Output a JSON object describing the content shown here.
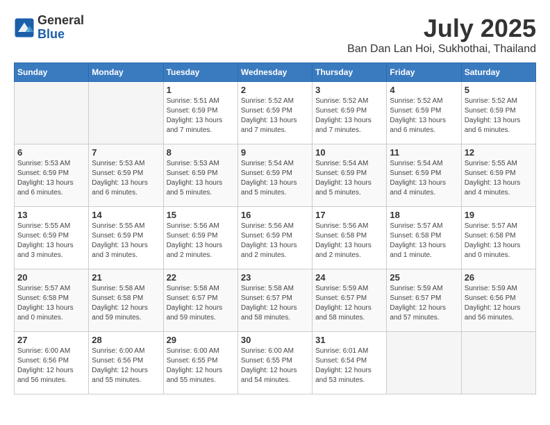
{
  "logo": {
    "general": "General",
    "blue": "Blue"
  },
  "title": "July 2025",
  "subtitle": "Ban Dan Lan Hoi, Sukhothai, Thailand",
  "headers": [
    "Sunday",
    "Monday",
    "Tuesday",
    "Wednesday",
    "Thursday",
    "Friday",
    "Saturday"
  ],
  "weeks": [
    [
      {
        "day": "",
        "info": ""
      },
      {
        "day": "",
        "info": ""
      },
      {
        "day": "1",
        "info": "Sunrise: 5:51 AM\nSunset: 6:59 PM\nDaylight: 13 hours\nand 7 minutes."
      },
      {
        "day": "2",
        "info": "Sunrise: 5:52 AM\nSunset: 6:59 PM\nDaylight: 13 hours\nand 7 minutes."
      },
      {
        "day": "3",
        "info": "Sunrise: 5:52 AM\nSunset: 6:59 PM\nDaylight: 13 hours\nand 7 minutes."
      },
      {
        "day": "4",
        "info": "Sunrise: 5:52 AM\nSunset: 6:59 PM\nDaylight: 13 hours\nand 6 minutes."
      },
      {
        "day": "5",
        "info": "Sunrise: 5:52 AM\nSunset: 6:59 PM\nDaylight: 13 hours\nand 6 minutes."
      }
    ],
    [
      {
        "day": "6",
        "info": "Sunrise: 5:53 AM\nSunset: 6:59 PM\nDaylight: 13 hours\nand 6 minutes."
      },
      {
        "day": "7",
        "info": "Sunrise: 5:53 AM\nSunset: 6:59 PM\nDaylight: 13 hours\nand 6 minutes."
      },
      {
        "day": "8",
        "info": "Sunrise: 5:53 AM\nSunset: 6:59 PM\nDaylight: 13 hours\nand 5 minutes."
      },
      {
        "day": "9",
        "info": "Sunrise: 5:54 AM\nSunset: 6:59 PM\nDaylight: 13 hours\nand 5 minutes."
      },
      {
        "day": "10",
        "info": "Sunrise: 5:54 AM\nSunset: 6:59 PM\nDaylight: 13 hours\nand 5 minutes."
      },
      {
        "day": "11",
        "info": "Sunrise: 5:54 AM\nSunset: 6:59 PM\nDaylight: 13 hours\nand 4 minutes."
      },
      {
        "day": "12",
        "info": "Sunrise: 5:55 AM\nSunset: 6:59 PM\nDaylight: 13 hours\nand 4 minutes."
      }
    ],
    [
      {
        "day": "13",
        "info": "Sunrise: 5:55 AM\nSunset: 6:59 PM\nDaylight: 13 hours\nand 3 minutes."
      },
      {
        "day": "14",
        "info": "Sunrise: 5:55 AM\nSunset: 6:59 PM\nDaylight: 13 hours\nand 3 minutes."
      },
      {
        "day": "15",
        "info": "Sunrise: 5:56 AM\nSunset: 6:59 PM\nDaylight: 13 hours\nand 2 minutes."
      },
      {
        "day": "16",
        "info": "Sunrise: 5:56 AM\nSunset: 6:59 PM\nDaylight: 13 hours\nand 2 minutes."
      },
      {
        "day": "17",
        "info": "Sunrise: 5:56 AM\nSunset: 6:58 PM\nDaylight: 13 hours\nand 2 minutes."
      },
      {
        "day": "18",
        "info": "Sunrise: 5:57 AM\nSunset: 6:58 PM\nDaylight: 13 hours\nand 1 minute."
      },
      {
        "day": "19",
        "info": "Sunrise: 5:57 AM\nSunset: 6:58 PM\nDaylight: 13 hours\nand 0 minutes."
      }
    ],
    [
      {
        "day": "20",
        "info": "Sunrise: 5:57 AM\nSunset: 6:58 PM\nDaylight: 13 hours\nand 0 minutes."
      },
      {
        "day": "21",
        "info": "Sunrise: 5:58 AM\nSunset: 6:58 PM\nDaylight: 12 hours\nand 59 minutes."
      },
      {
        "day": "22",
        "info": "Sunrise: 5:58 AM\nSunset: 6:57 PM\nDaylight: 12 hours\nand 59 minutes."
      },
      {
        "day": "23",
        "info": "Sunrise: 5:58 AM\nSunset: 6:57 PM\nDaylight: 12 hours\nand 58 minutes."
      },
      {
        "day": "24",
        "info": "Sunrise: 5:59 AM\nSunset: 6:57 PM\nDaylight: 12 hours\nand 58 minutes."
      },
      {
        "day": "25",
        "info": "Sunrise: 5:59 AM\nSunset: 6:57 PM\nDaylight: 12 hours\nand 57 minutes."
      },
      {
        "day": "26",
        "info": "Sunrise: 5:59 AM\nSunset: 6:56 PM\nDaylight: 12 hours\nand 56 minutes."
      }
    ],
    [
      {
        "day": "27",
        "info": "Sunrise: 6:00 AM\nSunset: 6:56 PM\nDaylight: 12 hours\nand 56 minutes."
      },
      {
        "day": "28",
        "info": "Sunrise: 6:00 AM\nSunset: 6:56 PM\nDaylight: 12 hours\nand 55 minutes."
      },
      {
        "day": "29",
        "info": "Sunrise: 6:00 AM\nSunset: 6:55 PM\nDaylight: 12 hours\nand 55 minutes."
      },
      {
        "day": "30",
        "info": "Sunrise: 6:00 AM\nSunset: 6:55 PM\nDaylight: 12 hours\nand 54 minutes."
      },
      {
        "day": "31",
        "info": "Sunrise: 6:01 AM\nSunset: 6:54 PM\nDaylight: 12 hours\nand 53 minutes."
      },
      {
        "day": "",
        "info": ""
      },
      {
        "day": "",
        "info": ""
      }
    ]
  ]
}
